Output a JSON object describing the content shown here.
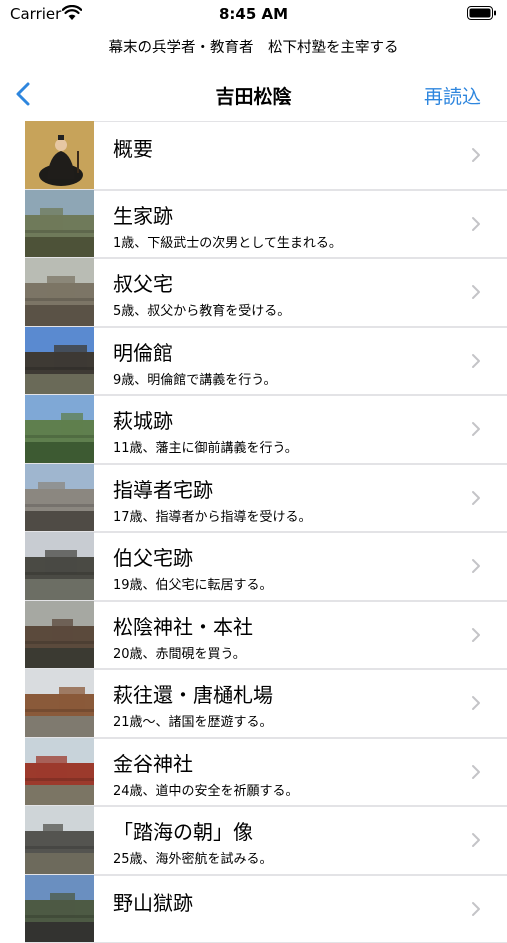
{
  "status": {
    "carrier": "Carrier",
    "time": "8:45 AM"
  },
  "subtitle": "幕末の兵学者・教育者　松下村塾を主宰する",
  "nav": {
    "title": "吉田松陰",
    "reload_label": "再読込"
  },
  "items": [
    {
      "title": "概要",
      "desc": ""
    },
    {
      "title": "生家跡",
      "desc": "1歳、下級武士の次男として生まれる。"
    },
    {
      "title": "叔父宅",
      "desc": "5歳、叔父から教育を受ける。"
    },
    {
      "title": "明倫館",
      "desc": "9歳、明倫館で講義を行う。"
    },
    {
      "title": "萩城跡",
      "desc": "11歳、藩主に御前講義を行う。"
    },
    {
      "title": "指導者宅跡",
      "desc": "17歳、指導者から指導を受ける。"
    },
    {
      "title": "伯父宅跡",
      "desc": "19歳、伯父宅に転居する。"
    },
    {
      "title": "松陰神社・本社",
      "desc": "20歳、赤間硯を買う。"
    },
    {
      "title": "萩往還・唐樋札場",
      "desc": "21歳～、諸国を歴遊する。"
    },
    {
      "title": "金谷神社",
      "desc": "24歳、道中の安全を祈願する。"
    },
    {
      "title": "「踏海の朝」像",
      "desc": "25歳、海外密航を試みる。"
    },
    {
      "title": "野山獄跡",
      "desc": ""
    }
  ]
}
